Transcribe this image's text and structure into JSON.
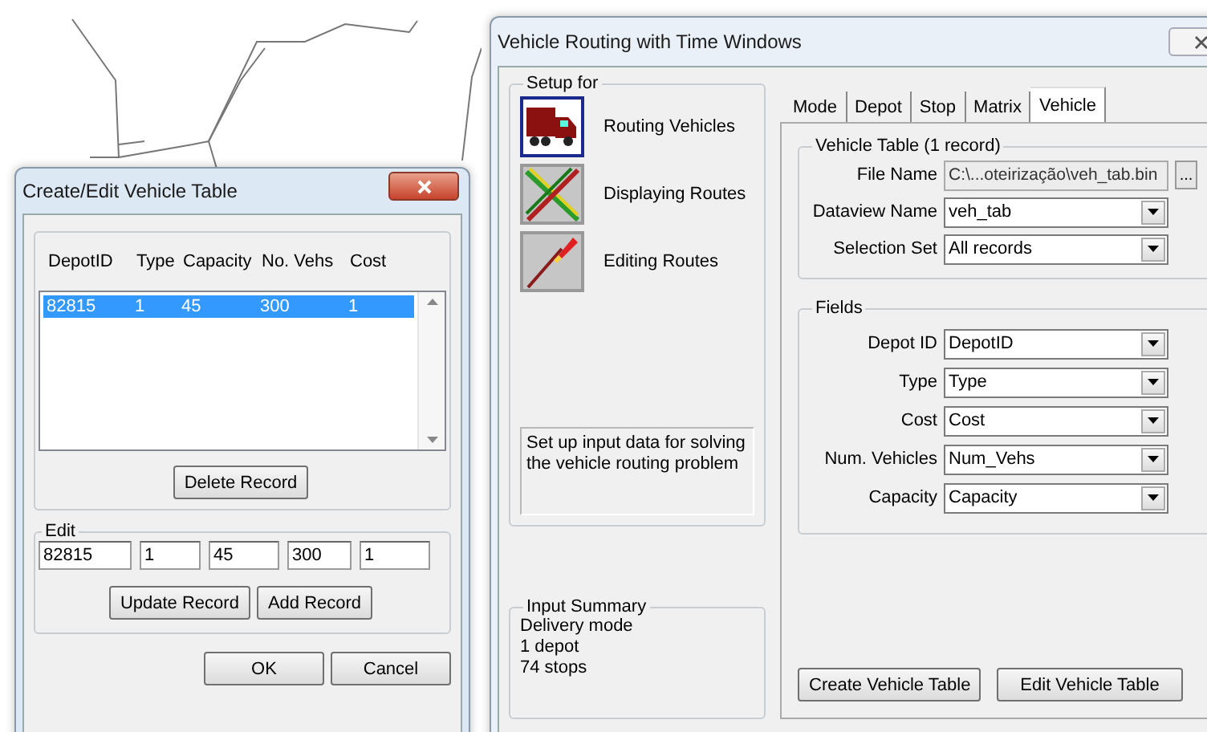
{
  "vehicle_table_dialog": {
    "title": "Create/Edit Vehicle Table",
    "list": {
      "columns": [
        "DepotID",
        "Type",
        "Capacity",
        "No. Vehs",
        "Cost"
      ],
      "rows": [
        {
          "cells": [
            "82815",
            "1",
            "45",
            "300",
            "1"
          ],
          "selected": true
        }
      ]
    },
    "delete_button": "Delete Record",
    "edit_group": {
      "label": "Edit",
      "values": [
        "82815",
        "1",
        "45",
        "300",
        "1"
      ],
      "buttons": [
        "Update Record",
        "Add Record"
      ]
    },
    "buttons": [
      "OK",
      "Cancel"
    ]
  },
  "routing_window": {
    "title": "Vehicle Routing with Time Windows",
    "setup_group": {
      "label": "Setup for",
      "items": [
        {
          "label": "Routing Vehicles",
          "kind": "truck",
          "selected": true
        },
        {
          "label": "Displaying Routes",
          "kind": "routes",
          "selected": false
        },
        {
          "label": "Editing Routes",
          "kind": "pencil",
          "selected": false
        }
      ],
      "description": "Set up input data for solving the vehicle routing problem"
    },
    "input_summary": {
      "label": "Input Summary",
      "lines": [
        "Delivery mode",
        "1 depot",
        "74 stops"
      ]
    },
    "tabs": [
      {
        "label": "Mode",
        "selected": false
      },
      {
        "label": "Depot",
        "selected": false
      },
      {
        "label": "Stop",
        "selected": false
      },
      {
        "label": "Matrix",
        "selected": false
      },
      {
        "label": "Vehicle",
        "selected": true
      }
    ],
    "vehicle_table_group": {
      "label": "Vehicle Table (1 record)",
      "file_name": {
        "label": "File Name",
        "value": "C:\\...oteirização\\veh_tab.bin",
        "browse": "..."
      },
      "selects": [
        {
          "label": "Dataview Name",
          "value": "veh_tab"
        },
        {
          "label": "Selection Set",
          "value": "All records"
        }
      ]
    },
    "fields_group": {
      "label": "Fields",
      "selects": [
        {
          "label": "Depot ID",
          "value": "DepotID"
        },
        {
          "label": "Type",
          "value": "Type"
        },
        {
          "label": "Cost",
          "value": "Cost"
        },
        {
          "label": "Num. Vehicles",
          "value": "Num_Vehs"
        },
        {
          "label": "Capacity",
          "value": "Capacity"
        }
      ]
    },
    "buttons": [
      "Create Vehicle Table",
      "Edit Vehicle Table"
    ]
  }
}
